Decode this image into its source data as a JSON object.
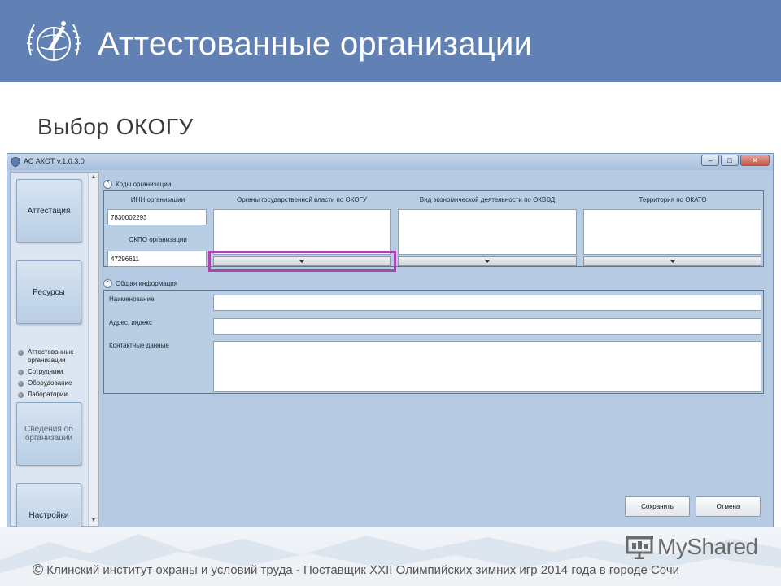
{
  "slide": {
    "title": "Аттестованные организации",
    "subtitle": "Выбор ОКОГУ",
    "footer": "Клинский институт охраны и условий труда - Поставщик XXII Олимпийских зимних игр 2014 года в городе Сочи",
    "watermark": "MyShared",
    "header_color": "#6180b4"
  },
  "window": {
    "title": "АС АКОТ v.1.0.3.0",
    "controls": [
      "minimize",
      "maximize",
      "close"
    ]
  },
  "nav": {
    "tiles": [
      {
        "label": "Аттестация"
      },
      {
        "label": "Ресурсы"
      },
      {
        "label": "Сведения об организации"
      },
      {
        "label": "Настройки"
      }
    ],
    "sub_items": [
      "Аттестованные организации",
      "Сотрудники",
      "Оборудование",
      "Лаборатории"
    ]
  },
  "codes": {
    "header": "Коды организации",
    "inn_label": "ИНН организации",
    "inn_value": "7830002293",
    "okpo_label": "ОКПО организации",
    "okpo_value": "47296611",
    "columns": [
      "Органы государственной власти по ОКОГУ",
      "Вид экономической деятельности по ОКВЭД",
      "Территория по ОКАТО"
    ]
  },
  "general": {
    "header": "Общая информация",
    "fields": [
      "Наименование",
      "Адрес, индекс",
      "Контактные данные"
    ]
  },
  "buttons": {
    "save": "Сохранить",
    "cancel": "Отмена"
  },
  "colors": {
    "highlight": "#a549b0",
    "window_bg": "#b6cbe3"
  }
}
